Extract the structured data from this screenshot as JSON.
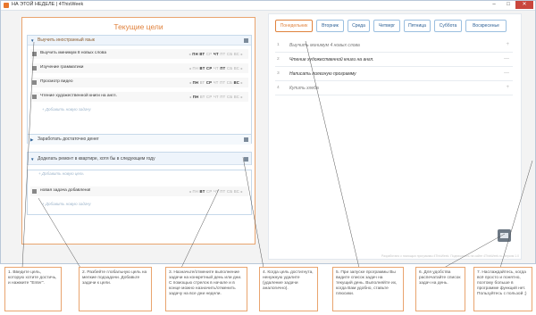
{
  "window": {
    "title": "НА ЭТОЙ НЕДЕЛЕ | 4ThisWeek",
    "minimize": "–",
    "maximize": "□",
    "close": "✕"
  },
  "left_panel": {
    "title": "Текущие цели",
    "goals": [
      {
        "title": "Выучить иностранный язык",
        "tasks": [
          {
            "name": "Выучить минимум 8 новых слова",
            "days": [
              "ПН",
              "ВТ",
              "СР",
              "ЧТ",
              "ПТ",
              "СБ",
              "ВС"
            ]
          },
          {
            "name": "Изучение грамматики",
            "days": [
              "ПН",
              "ВТ",
              "СР",
              "ЧТ",
              "ПТ",
              "СБ",
              "ВС"
            ]
          },
          {
            "name": "Просмотр видео",
            "days": [
              "ПН",
              "ВТ",
              "СР",
              "ЧТ",
              "ПТ",
              "СБ",
              "ВС"
            ]
          },
          {
            "name": "Чтение художественной книги на англ.",
            "days": [
              "ПН",
              "ВТ",
              "СР",
              "ЧТ",
              "ПТ",
              "СБ",
              "ВС"
            ]
          }
        ],
        "add_task": "+ Добавить новую задачу"
      },
      {
        "title": "Заработать достаточно денег"
      },
      {
        "title": "Доделать ремонт в квартире, хотя бы в следующем году",
        "add_goal": "+ Добавить новую цель",
        "tasks": [
          {
            "name": "новая задача добавлена!",
            "days": [
              "ПН",
              "ВТ",
              "СР",
              "ЧТ",
              "ПТ",
              "СБ",
              "ВС"
            ]
          }
        ],
        "add_task": "+ Добавить новую задачу"
      }
    ]
  },
  "right_panel": {
    "tabs": [
      "Понедельник",
      "Вторник",
      "Среда",
      "Четверг",
      "Пятница",
      "Суббота",
      "Воскресенье"
    ],
    "active_tab": "Понедельник",
    "items": [
      {
        "num": "1",
        "text": "Выучить минимум 4 новых слова",
        "ctrl": "+"
      },
      {
        "num": "2",
        "text": "Чтение художественной книги на англ.",
        "ctrl": "—"
      },
      {
        "num": "3",
        "text": "Написать полезную программу",
        "ctrl": "—"
      },
      {
        "num": "4",
        "text": "Купить хлеба",
        "ctrl": "+"
      }
    ],
    "footnote": "Разработано с помощью программы 4ThisWeek. Подпишитесь на сайте 4ThisWeek.ru. Версия 1.0"
  },
  "callouts": [
    "1. Введите цель, которую хотите достичь, и нажмите \"Enter\".",
    "2. Разбейте глобальную цель на мелкие подзадачи. Добавьте задачи к цели.",
    "3. Назначьте/отмените выполнение задачи на конкретный день или дни. С помощью стрелок в начале и в конце можно назначить/отменить задачу на все дни недели.",
    "4. Когда цель достигнута, ненужную удалите (удаление задачи аналогично).",
    "5. При запуске программы Вы видите список задач на текущий день. Выполняйте их, когда Вам удобно, ставьте плюсики.",
    "6. Для удобства распечатайте список задач на день.",
    "7. Наслаждайтесь, когда всё просто и понятно, поэтому больше в программе функций нет. Пользуйтесь с пользой ;)"
  ],
  "colors": {
    "accent": "#e0823d",
    "link": "#2b5f95",
    "border": "#c7d9ea"
  }
}
